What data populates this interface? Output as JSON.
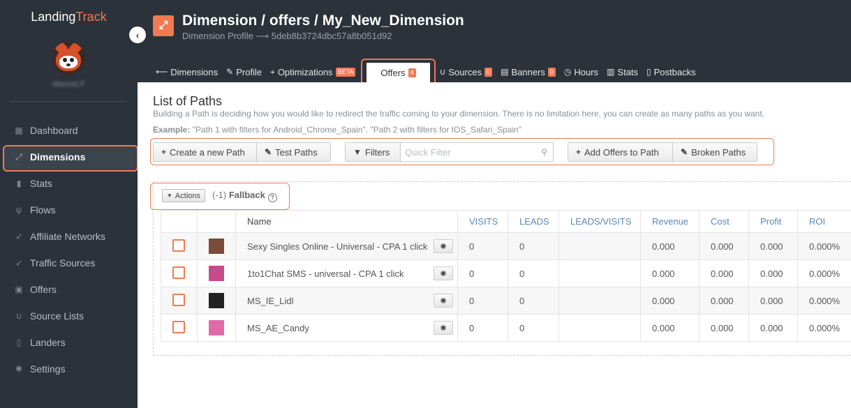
{
  "brand": {
    "part1": "Landing",
    "part2": "Track"
  },
  "user": {
    "name": "Marcos F"
  },
  "collapse_icon": "chevron-left-icon",
  "nav": [
    {
      "label": "Dashboard",
      "icon": "dashboard-icon",
      "glyph": "▦"
    },
    {
      "label": "Dimensions",
      "icon": "expand-icon",
      "glyph": "⤢",
      "active": true
    },
    {
      "label": "Stats",
      "icon": "bar-chart-icon",
      "glyph": "▮"
    },
    {
      "label": "Flows",
      "icon": "fork-icon",
      "glyph": "ψ"
    },
    {
      "label": "Affiliate Networks",
      "icon": "rocket-icon",
      "glyph": "➶"
    },
    {
      "label": "Traffic Sources",
      "icon": "rocket-icon",
      "glyph": "➶"
    },
    {
      "label": "Offers",
      "icon": "image-icon",
      "glyph": "▣"
    },
    {
      "label": "Source Lists",
      "icon": "magnet-icon",
      "glyph": "∪"
    },
    {
      "label": "Landers",
      "icon": "file-icon",
      "glyph": "▯"
    },
    {
      "label": "Settings",
      "icon": "gear-icon",
      "glyph": "✺"
    }
  ],
  "header": {
    "title": "Dimension / offers / My_New_Dimension",
    "subtitle": "Dimension Profile ⟶ 5deb8b3724dbc57a8b051d92",
    "icon": "expand-icon"
  },
  "tabs": [
    {
      "label": "Dimensions",
      "icon": "arrow-left-icon",
      "glyph": "⟵"
    },
    {
      "label": "Profile",
      "icon": "pen-icon",
      "glyph": "✎"
    },
    {
      "label": "Optimizations",
      "icon": "crosshair-icon",
      "glyph": "⌖",
      "badge": "BETA"
    },
    {
      "label": "Offers",
      "badge": "4",
      "active": true
    },
    {
      "label": "Sources",
      "icon": "magnet-icon",
      "glyph": "∪",
      "badge": "0"
    },
    {
      "label": "Banners",
      "icon": "keyboard-icon",
      "glyph": "▤",
      "badge": "0"
    },
    {
      "label": "Hours",
      "icon": "clock-icon",
      "glyph": "◷"
    },
    {
      "label": "Stats",
      "icon": "bar-chart-icon",
      "glyph": "▥"
    },
    {
      "label": "Postbacks",
      "icon": "file-icon",
      "glyph": "▯"
    }
  ],
  "content": {
    "title": "List of Paths",
    "description": "Building a Path is deciding how you would like to redirect the traffic coming to your dimension. There is no limitation here, you can create as many paths as you want.",
    "example_label": "Example:",
    "example_text": " \"Path 1 with filters for Android_Chrome_Spain\". \"Path 2 with filters for IOS_Safari_Spain\""
  },
  "toolbar": {
    "create_path": "Create a new Path",
    "test_paths": "Test Paths",
    "filters": "Filters",
    "quick_filter_placeholder": "Quick Filter",
    "add_offers": "Add Offers to Path",
    "broken_paths": "Broken Paths"
  },
  "path": {
    "actions_label": "Actions",
    "prefix": "(-1)",
    "name": "Fallback"
  },
  "table": {
    "headers": {
      "name": "Name",
      "visits": "VISITS",
      "leads": "LEADS",
      "leads_visits": "LEADS/VISITS",
      "revenue": "Revenue",
      "cost": "Cost",
      "profit": "Profit",
      "roi": "ROI"
    },
    "rows": [
      {
        "name": "Sexy Singles Online - Universal - CPA 1 click",
        "visits": "0",
        "leads": "0",
        "revenue": "0.000",
        "cost": "0.000",
        "profit": "0.000",
        "roi": "0.000%",
        "thumb_color": "#7a4a3a"
      },
      {
        "name": "1to1Chat SMS - universal - CPA 1 click",
        "visits": "0",
        "leads": "0",
        "revenue": "0.000",
        "cost": "0.000",
        "profit": "0.000",
        "roi": "0.000%",
        "thumb_color": "#c94a8a"
      },
      {
        "name": "MS_IE_Lidl",
        "visits": "0",
        "leads": "0",
        "revenue": "0.000",
        "cost": "0.000",
        "profit": "0.000",
        "roi": "0.000%",
        "thumb_color": "#222222"
      },
      {
        "name": "MS_AE_Candy",
        "visits": "0",
        "leads": "0",
        "revenue": "0.000",
        "cost": "0.000",
        "profit": "0.000",
        "roi": "0.000%",
        "thumb_color": "#e06aa8"
      }
    ]
  },
  "colors": {
    "accent": "#f07a52",
    "sidebar": "#2b323a",
    "metric_header": "#5a86b8"
  }
}
